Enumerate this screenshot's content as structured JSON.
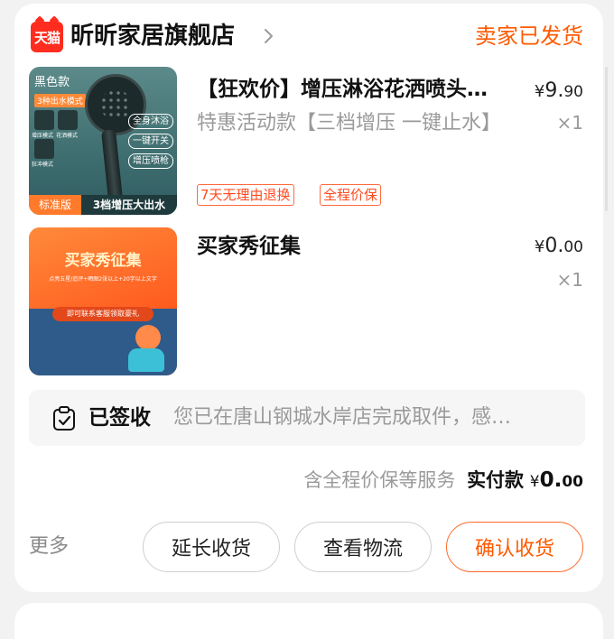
{
  "shop": {
    "logo_text": "天猫",
    "name": "昕昕家居旗舰店",
    "order_status": "卖家已发货"
  },
  "items": [
    {
      "title": "【狂欢价】增压淋浴花洒喷头…",
      "price_symbol": "¥",
      "price_int": "9.",
      "price_dec": "90",
      "spec": "特惠活动款【三档增压 一键止水】",
      "qty": "×1",
      "tags": [
        "7天无理由退换",
        "全程价保"
      ],
      "image": {
        "color_label": "黑色款",
        "mode_label": "3种出水模式",
        "modes": [
          "增压模式",
          "花洒模式",
          "狂冲模式"
        ],
        "features": [
          "全身沐浴",
          "一键开关",
          "增压喷枪"
        ],
        "version_label": "标准版",
        "banner": "3档增压大出水"
      }
    },
    {
      "title": "买家秀征集",
      "price_symbol": "¥",
      "price_int": "0.",
      "price_dec": "00",
      "qty": "×1",
      "image": {
        "title": "买家秀征集",
        "subtitle": "点亮五星/追评+晒图2张以上+20字以上文字",
        "cta": "即可联系客服领取豪礼"
      }
    }
  ],
  "delivery": {
    "status": "已签收",
    "message": "您已在唐山钢城水岸店完成取件，感…"
  },
  "summary": {
    "service_text": "含全程价保等服务",
    "paid_label": "实付款",
    "symbol": "¥",
    "amount_int": "0.",
    "amount_dec": "00"
  },
  "actions": {
    "more": "更多",
    "extend": "延长收货",
    "logistics": "查看物流",
    "confirm": "确认收货"
  },
  "colors": {
    "accent": "#ff5a00",
    "brand_red": "#ff2d1f"
  }
}
